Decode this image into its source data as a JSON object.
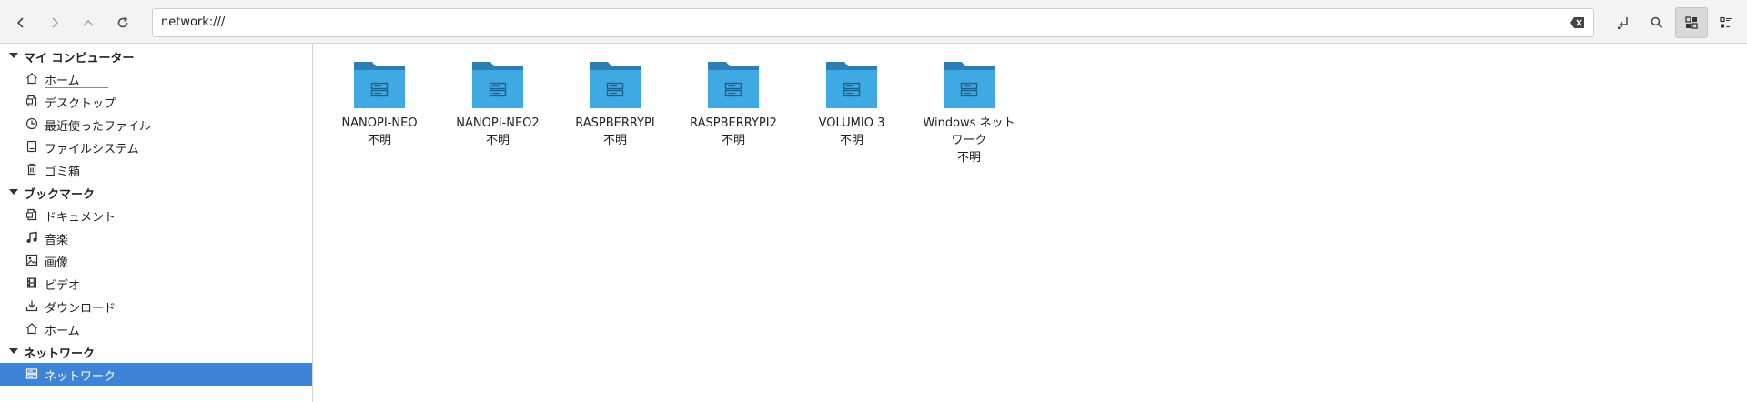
{
  "toolbar": {
    "back_icon": "chevron-left-icon",
    "forward_icon": "chevron-right-icon",
    "up_icon": "arrow-up-icon",
    "reload_icon": "refresh-icon",
    "location": "network:///",
    "clear_icon": "backspace-clear-icon",
    "path_toggle_icon": "edit-path-icon",
    "search_icon": "search-icon",
    "icon_view_icon": "grid-view-icon",
    "list_view_icon": "list-view-icon"
  },
  "sidebar": {
    "sections": [
      {
        "title": "マイ コンピューター",
        "items": [
          {
            "label": "ホーム",
            "icon": "home-icon"
          },
          {
            "label": "デスクトップ",
            "icon": "desktop-icon"
          },
          {
            "label": "最近使ったファイル",
            "icon": "recent-icon"
          },
          {
            "label": "ファイルシステム",
            "icon": "drive-icon"
          },
          {
            "label": "ゴミ箱",
            "icon": "trash-icon"
          }
        ]
      },
      {
        "title": "ブックマーク",
        "items": [
          {
            "label": "ドキュメント",
            "icon": "document-icon"
          },
          {
            "label": "音楽",
            "icon": "music-icon"
          },
          {
            "label": "画像",
            "icon": "image-icon"
          },
          {
            "label": "ビデオ",
            "icon": "video-icon"
          },
          {
            "label": "ダウンロード",
            "icon": "download-icon"
          },
          {
            "label": "ホーム",
            "icon": "home-icon"
          }
        ]
      },
      {
        "title": "ネットワーク",
        "items": [
          {
            "label": "ネットワーク",
            "icon": "network-server-icon",
            "selected": true
          }
        ]
      }
    ]
  },
  "files": [
    {
      "name": "NANOPI-NEO",
      "status": "不明"
    },
    {
      "name": "NANOPI-NEO2",
      "status": "不明"
    },
    {
      "name": "RASPBERRYPI",
      "status": "不明"
    },
    {
      "name": "RASPBERRYPI2",
      "status": "不明"
    },
    {
      "name": "VOLUMIO 3",
      "status": "不明"
    },
    {
      "name": "Windows ネット",
      "name2": "ワーク",
      "status": "不明"
    }
  ],
  "colors": {
    "folder_front": "#3fa9e4",
    "folder_back": "#2b7fb4",
    "selection": "#3d83d8"
  }
}
